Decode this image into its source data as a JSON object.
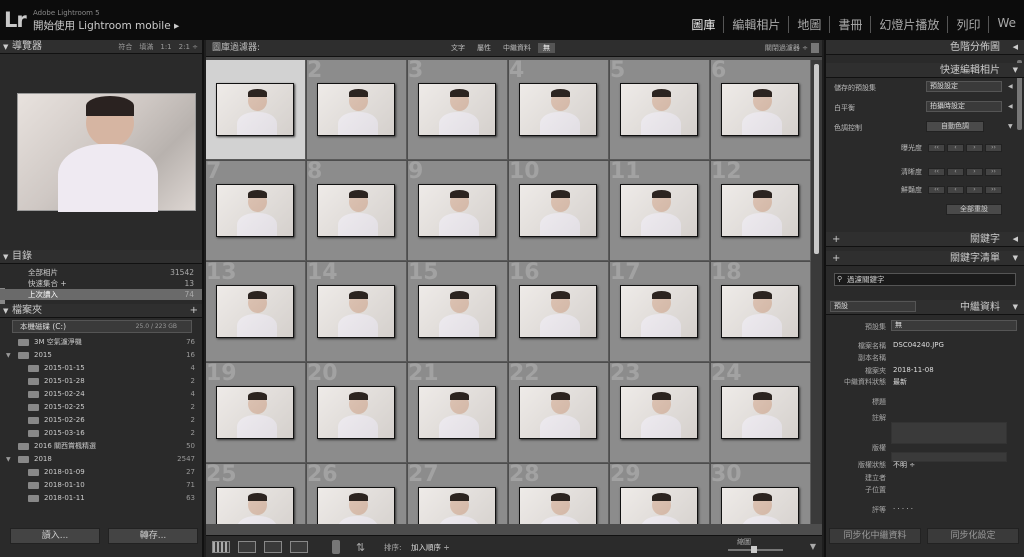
{
  "app": {
    "adobe_label": "Adobe Lightroom 5",
    "identity": "開始使用 Lightroom mobile ▸",
    "logo": "Lr"
  },
  "modules": [
    "圖庫",
    "編輯相片",
    "地圖",
    "書冊",
    "幻燈片播放",
    "列印",
    "We"
  ],
  "navigator": {
    "title": "導覽器",
    "zoom_options": [
      "符合",
      "填滿",
      "1:1",
      "2:1 ÷"
    ]
  },
  "catalog": {
    "title": "目錄",
    "items": [
      {
        "label": "全部相片",
        "count": "31542"
      },
      {
        "label": "快速集合 +",
        "count": "13"
      },
      {
        "label": "上次讀入",
        "count": "74"
      }
    ]
  },
  "folders": {
    "title": "檔案夾",
    "add_icon": "+",
    "disk": {
      "label": "本機磁碟 (C:)",
      "size": "25.0 / 223 GB"
    },
    "items": [
      {
        "label": "3M 空氣濾淨機",
        "count": "76",
        "indent": 1
      },
      {
        "label": "2015",
        "count": "16",
        "indent": 0
      },
      {
        "label": "2015-01-15",
        "count": "4",
        "indent": 2
      },
      {
        "label": "2015-01-28",
        "count": "2",
        "indent": 2
      },
      {
        "label": "2015-02-24",
        "count": "4",
        "indent": 2
      },
      {
        "label": "2015-02-25",
        "count": "2",
        "indent": 2
      },
      {
        "label": "2015-02-26",
        "count": "2",
        "indent": 2
      },
      {
        "label": "2015-03-16",
        "count": "2",
        "indent": 2
      },
      {
        "label": "2016 關西賞楓精選",
        "count": "50",
        "indent": 1
      },
      {
        "label": "2018",
        "count": "2547",
        "indent": 0
      },
      {
        "label": "2018-01-09",
        "count": "27",
        "indent": 2
      },
      {
        "label": "2018-01-10",
        "count": "71",
        "indent": 2
      },
      {
        "label": "2018-01-11",
        "count": "63",
        "indent": 2
      }
    ]
  },
  "left_buttons": {
    "import": "讀入...",
    "export": "轉存..."
  },
  "filter_bar": {
    "label": "圖庫過濾器:",
    "options": [
      "文字",
      "屬性",
      "中繼資料",
      "無"
    ],
    "active": "無",
    "right": "關閉過濾器 ÷"
  },
  "grid": {
    "cells": [
      2,
      3,
      4,
      5,
      6,
      7,
      8,
      9,
      10,
      11,
      12,
      13,
      14,
      15,
      16,
      17,
      18,
      19,
      20,
      21,
      22,
      23,
      24,
      25,
      26,
      27,
      28,
      29,
      30
    ],
    "selected_index": 0
  },
  "toolbar": {
    "sort_label": "排序:",
    "sort_value": "加入順序 ÷",
    "zoom_label": "縮圖"
  },
  "right": {
    "histogram": "色階分佈圖",
    "quick_develop": "快速編輯相片",
    "saved_preset_label": "儲存的預設集",
    "saved_preset_value": "預設設定",
    "wb_label": "白平衡",
    "wb_value": "拍攝時設定",
    "tone_label": "色調控制",
    "auto_tone": "自動色調",
    "exposure_label": "曝光度",
    "clarity_label": "清晰度",
    "vibrance_label": "鮮豔度",
    "reset_all": "全部重設",
    "keywording": "關鍵字",
    "keyword_list": "關鍵字清單",
    "keyword_filter_placeholder": "過濾關鍵字",
    "metadata": "中繼資料",
    "metadata_preset_select": "預設",
    "md_preset_label": "預設集",
    "md_preset_value": "無",
    "md_fields": [
      {
        "label": "檔案名稱",
        "value": "DSC04240.JPG"
      },
      {
        "label": "副本名稱",
        "value": ""
      },
      {
        "label": "檔案夾",
        "value": "2018-11-08"
      },
      {
        "label": "中繼資料狀態",
        "value": "最新"
      },
      {
        "label": "標題",
        "value": ""
      },
      {
        "label": "註解",
        "value": ""
      },
      {
        "label": "版權",
        "value": ""
      },
      {
        "label": "版權狀態",
        "value": "不明 ÷"
      },
      {
        "label": "建立者",
        "value": ""
      },
      {
        "label": "子位置",
        "value": ""
      },
      {
        "label": "評等",
        "value": "· · · · ·"
      }
    ],
    "sync_metadata": "同步化中繼資料",
    "sync_settings": "同步化設定"
  }
}
